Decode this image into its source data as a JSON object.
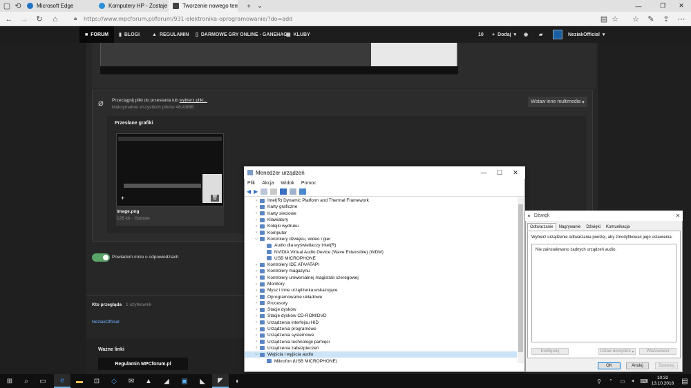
{
  "browser": {
    "tabs": [
      {
        "label": "Microsoft Edge"
      },
      {
        "label": "Komputery HP - Zostaje wy"
      },
      {
        "label": "Tworzenie nowego tem"
      }
    ],
    "url": "https://www.mpcforum.pl/forum/931-elektronika-oprogramowanie/?do=add"
  },
  "forum_nav": {
    "items": [
      "FORUM",
      "BLOGI",
      "REGULAMIN",
      "DARMOWE GRY ONLINE - GANEHAG",
      "KLUBY"
    ],
    "count": "10",
    "add_label": "Dodaj",
    "username": "NeziakOfficial"
  },
  "upload": {
    "drag_text": "Przeciągnij pliki do przesłania lub",
    "choose_link": "wybierz pliki...",
    "max_size": "Maksymalnie wszystkich plików 48,43MB",
    "insert_media": "Wstaw inne multimedia",
    "uploaded_heading": "Przesłane grafiki",
    "file_name": "image.png",
    "file_meta": "126 kb · Gotowe"
  },
  "notify_label": "Powiadom mnie o odpowiedziach",
  "who": {
    "heading": "Kto przegląda",
    "count": "1 użytkownik",
    "user": "NeziakOfficial"
  },
  "links": {
    "heading": "Ważne linki",
    "rules": "Regulamin MPCforum.pl"
  },
  "device_manager": {
    "title": "Menedżer urządzeń",
    "menu": [
      "Plik",
      "Akcja",
      "Widok",
      "Pomoc"
    ],
    "tree": [
      {
        "label": "Intel(R) Dynamic Platform and Thermal Framework",
        "level": 0,
        "state": "collapsed"
      },
      {
        "label": "Karty graficzne",
        "level": 0,
        "state": "collapsed"
      },
      {
        "label": "Karty sieciowe",
        "level": 0,
        "state": "collapsed"
      },
      {
        "label": "Klawiatury",
        "level": 0,
        "state": "collapsed"
      },
      {
        "label": "Kolejki wydruku",
        "level": 0,
        "state": "collapsed"
      },
      {
        "label": "Komputer",
        "level": 0,
        "state": "collapsed"
      },
      {
        "label": "Kontrolery dźwięku, wideo i gier",
        "level": 0,
        "state": "expanded"
      },
      {
        "label": "Audio dla wyświetlaczy Intel(R)",
        "level": 1,
        "state": "leaf"
      },
      {
        "label": "NVIDIA Virtual Audio Device (Wave Extensible) (WDM)",
        "level": 1,
        "state": "leaf"
      },
      {
        "label": "USB MICROPHONE",
        "level": 1,
        "state": "leaf"
      },
      {
        "label": "Kontrolery IDE ATA/ATAPI",
        "level": 0,
        "state": "collapsed"
      },
      {
        "label": "Kontrolery magazynu",
        "level": 0,
        "state": "collapsed"
      },
      {
        "label": "Kontrolery uniwersalnej magistrali szeregowej",
        "level": 0,
        "state": "collapsed"
      },
      {
        "label": "Monitory",
        "level": 0,
        "state": "collapsed"
      },
      {
        "label": "Mysz i inne urządzenia wskazujące",
        "level": 0,
        "state": "collapsed"
      },
      {
        "label": "Oprogramowanie układowe",
        "level": 0,
        "state": "collapsed"
      },
      {
        "label": "Procesory",
        "level": 0,
        "state": "collapsed"
      },
      {
        "label": "Stacje dysków",
        "level": 0,
        "state": "collapsed"
      },
      {
        "label": "Stacje dysków CD-ROM/DVD",
        "level": 0,
        "state": "collapsed"
      },
      {
        "label": "Urządzenia interfejsu HID",
        "level": 0,
        "state": "collapsed"
      },
      {
        "label": "Urządzenia programowe",
        "level": 0,
        "state": "collapsed"
      },
      {
        "label": "Urządzenia systemowe",
        "level": 0,
        "state": "collapsed"
      },
      {
        "label": "Urządzenia technologii pamięci",
        "level": 0,
        "state": "collapsed"
      },
      {
        "label": "Urządzenia zabezpieczeń",
        "level": 0,
        "state": "collapsed"
      },
      {
        "label": "Wejścia i wyjścia audio",
        "level": 0,
        "state": "expanded",
        "selected": true
      },
      {
        "label": "Mikrofon (USB MICROPHONE)",
        "level": 1,
        "state": "leaf"
      }
    ]
  },
  "sound": {
    "title": "Dźwięk",
    "tabs": [
      "Odtwarzanie",
      "Nagrywanie",
      "Dźwięki",
      "Komunikacja"
    ],
    "instruction": "Wybierz urządzenie odtwarzania poniżej, aby zmodyfikować jego ustawienia:",
    "empty": "Nie zainstalowano żadnych urządzeń audio.",
    "configure": "Konfiguruj",
    "set_default": "Ustaw domyślne",
    "properties": "Właściwości",
    "ok": "OK",
    "cancel": "Anuluj",
    "apply": "Zastosuj"
  },
  "taskbar": {
    "time": "10:32",
    "date": "13.10.2018"
  },
  "colors": {
    "accent": "#0078d7",
    "toggle": "#5aa469",
    "selection": "#cce4f7"
  }
}
